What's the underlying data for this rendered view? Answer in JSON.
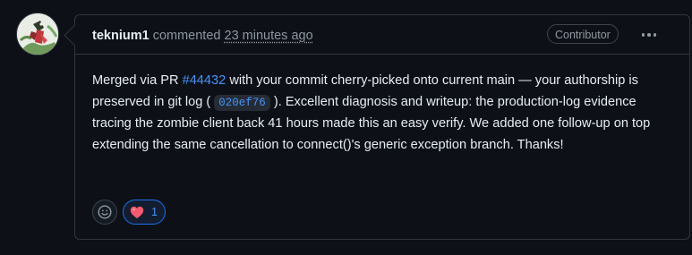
{
  "comment": {
    "author": "teknium1",
    "action": "commented",
    "timestamp": "23 minutes ago",
    "role_badge": "Contributor",
    "body": {
      "p1": "Merged via PR ",
      "pr_link": "#44432",
      "p2": " with your commit cherry-picked onto current main — your authorship is preserved in git log ( ",
      "commit_hash": "020ef76",
      "p3": " ). Excellent diagnosis and writeup: the production-log evidence tracing the zombie client back 41 hours made this an easy verify. We added one follow-up on top extending the same cancellation to connect()'s generic exception branch. Thanks!"
    },
    "reactions": [
      {
        "emoji": "heart",
        "count": "1"
      }
    ]
  },
  "icons": {
    "avatar": "avatar-image",
    "menu": "kebab-icon",
    "add_reaction": "smiley-icon",
    "reaction": "heart-icon"
  },
  "colors": {
    "background": "#0d1117",
    "border": "#30363d",
    "link": "#4493f8",
    "muted": "#8d96a0",
    "heart": "#f85a6d"
  }
}
